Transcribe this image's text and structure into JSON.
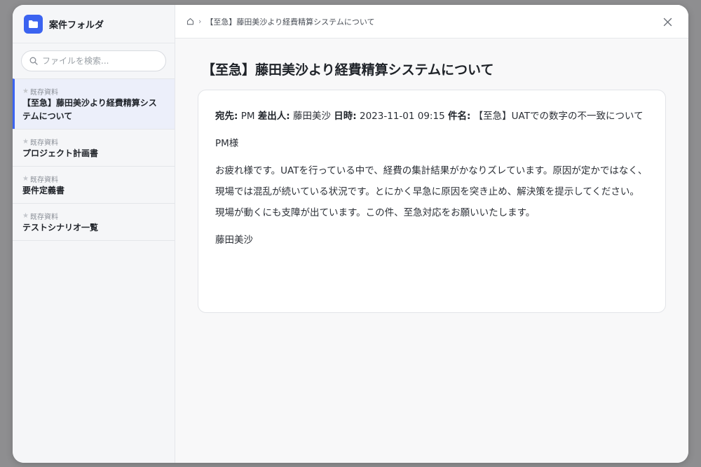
{
  "app": {
    "title": "案件フォルダ"
  },
  "search": {
    "placeholder": "ファイルを検索..."
  },
  "files": [
    {
      "category": "既存資料",
      "name": "【至急】藤田美沙より経費精算システムについて",
      "active": true
    },
    {
      "category": "既存資料",
      "name": "プロジェクト計画書",
      "active": false
    },
    {
      "category": "既存資料",
      "name": "要件定義書",
      "active": false
    },
    {
      "category": "既存資料",
      "name": "テストシナリオ一覧",
      "active": false
    }
  ],
  "breadcrumb": {
    "separator": "›",
    "current": "【至急】藤田美沙より経費精算システムについて"
  },
  "document": {
    "title": "【至急】藤田美沙より経費精算システムについて",
    "to_label": "宛先:",
    "to_value": "PM",
    "from_label": "差出人:",
    "from_value": "藤田美沙",
    "date_label": "日時:",
    "date_value": "2023-11-01 09:15",
    "subject_label": "件名:",
    "subject_value": "【至急】UATでの数字の不一致について",
    "greeting": "PM様",
    "body": "お疲れ様です。UATを行っている中で、経費の集計結果がかなりズレています。原因が定かではなく、現場では混乱が続いている状況です。とにかく早急に原因を突き止め、解決策を提示してください。現場が動くにも支障が出ています。この件、至急対応をお願いいたします。",
    "signature": "藤田美沙"
  },
  "icons": {
    "logo": "folder-icon",
    "search": "search-icon",
    "home": "home-icon",
    "close": "close-icon",
    "star": "star-icon"
  },
  "colors": {
    "accent": "#3b63f0",
    "sidebar_bg": "#f5f6f8",
    "active_item_bg": "#eceffa"
  }
}
